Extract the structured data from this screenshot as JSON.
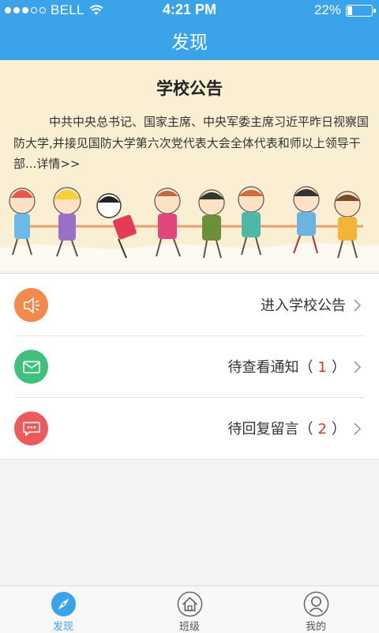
{
  "status_bar": {
    "carrier": "BELL",
    "time": "4:21 PM",
    "battery_text": "22%",
    "battery_level": 0.22
  },
  "nav": {
    "title": "发现"
  },
  "announcement": {
    "title": "学校公告",
    "body": "中共中央总书记、国家主席、中央军委主席习近平昨日视察国防大学,并接见国防大学第六次党代表大会全体代表和师以上领导干部...",
    "more": "详情>>"
  },
  "list": {
    "items": [
      {
        "label": "进入学校公告",
        "count": "",
        "icon": "speaker-icon",
        "color": "#f28a4e"
      },
      {
        "label": "待查看通知（",
        "count": "1",
        "suffix": "）",
        "icon": "mail-icon",
        "color": "#3fc07c"
      },
      {
        "label": "待回复留言（",
        "count": "2",
        "suffix": "）",
        "icon": "chat-bubble-icon",
        "color": "#ee5a5c"
      }
    ]
  },
  "tabbar": {
    "tabs": [
      {
        "label": "发现",
        "icon": "compass-icon",
        "active": true
      },
      {
        "label": "班级",
        "icon": "home-icon",
        "active": false
      },
      {
        "label": "我的",
        "icon": "user-icon",
        "active": false
      }
    ]
  },
  "colors": {
    "primary": "#3aa3ea",
    "banner_bg": "#fbefd3",
    "count_red": "#e4322a"
  }
}
